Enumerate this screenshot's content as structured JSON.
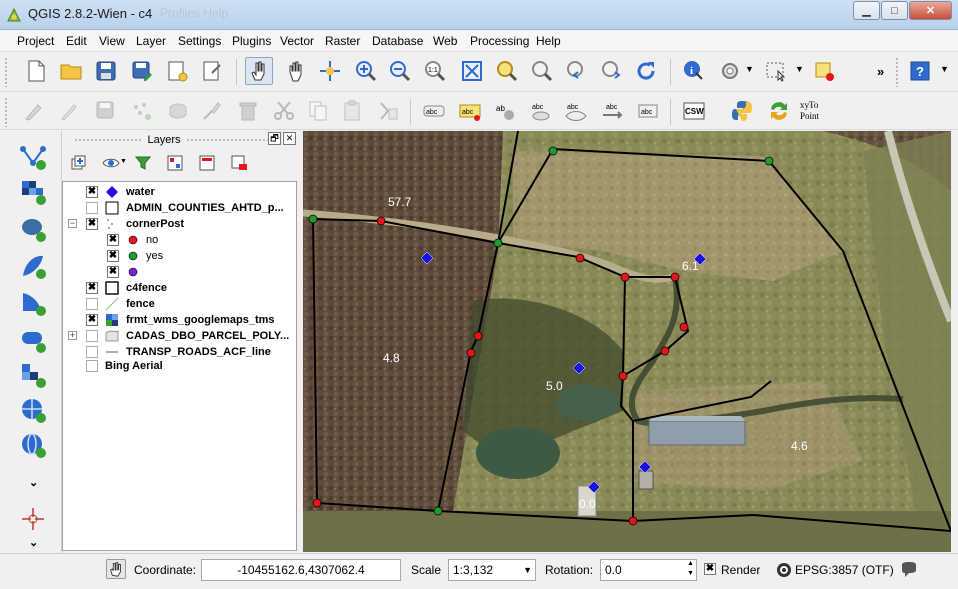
{
  "window": {
    "title": "QGIS 2.8.2-Wien - c4",
    "ghost_text": "Profiles    Help",
    "minimize": "▁",
    "maximize": "□",
    "close": "✕"
  },
  "menu": [
    "Project",
    "Edit",
    "View",
    "Layer",
    "Settings",
    "Plugins",
    "Vector",
    "Raster",
    "Database",
    "Web",
    "Processing",
    "Help"
  ],
  "toolbar_overflow": "»",
  "plugin_labels": {
    "csw": "CSW",
    "xy_line1": "xyTo",
    "xy_line2": "Point"
  },
  "layers_panel": {
    "title": "Layers",
    "float_btn": "🗗",
    "close_btn": "✕",
    "rows": [
      {
        "label": "water",
        "checked": true,
        "bold": true
      },
      {
        "label": "ADMIN_COUNTIES_AHTD_p...",
        "checked": false,
        "bold": true
      },
      {
        "label": "cornerPost",
        "checked": true,
        "bold": true
      },
      {
        "label": "no",
        "checked": true,
        "bold": false
      },
      {
        "label": "yes",
        "checked": true,
        "bold": false
      },
      {
        "label": "",
        "checked": true,
        "bold": false
      },
      {
        "label": "c4fence",
        "checked": true,
        "bold": true
      },
      {
        "label": "fence",
        "checked": false,
        "bold": true
      },
      {
        "label": "frmt_wms_googlemaps_tms",
        "checked": true,
        "bold": true
      },
      {
        "label": "CADAS_DBO_PARCEL_POLY...",
        "checked": false,
        "bold": true
      },
      {
        "label": "TRANSP_ROADS_ACF_line",
        "checked": false,
        "bold": true
      },
      {
        "label": "Bing Aerial",
        "checked": false,
        "bold": true
      }
    ],
    "expand_minus": "−",
    "expand_plus": "+",
    "check_mark": "✖"
  },
  "map": {
    "labels": [
      "57.7",
      "6.1",
      "4.8",
      "5.0",
      "4.6",
      "0.0"
    ]
  },
  "status": {
    "coordinate_label": "Coordinate:",
    "coordinate_value": "-10455162.6,4307062.4",
    "scale_label": "Scale",
    "scale_value": "1:3,132",
    "rotation_label": "Rotation:",
    "rotation_value": "0.0",
    "render_label": "Render",
    "render_checked": true,
    "crs": "EPSG:3857 (OTF)"
  },
  "colors": {
    "post_no": "#e8141b",
    "post_yes": "#1f9c2a",
    "post_other": "#7b22d6",
    "water": "#1a10e6",
    "fence": "#000000"
  },
  "icons": {
    "app": "qgis-logo-icon",
    "message": "speech-bubble-icon"
  }
}
